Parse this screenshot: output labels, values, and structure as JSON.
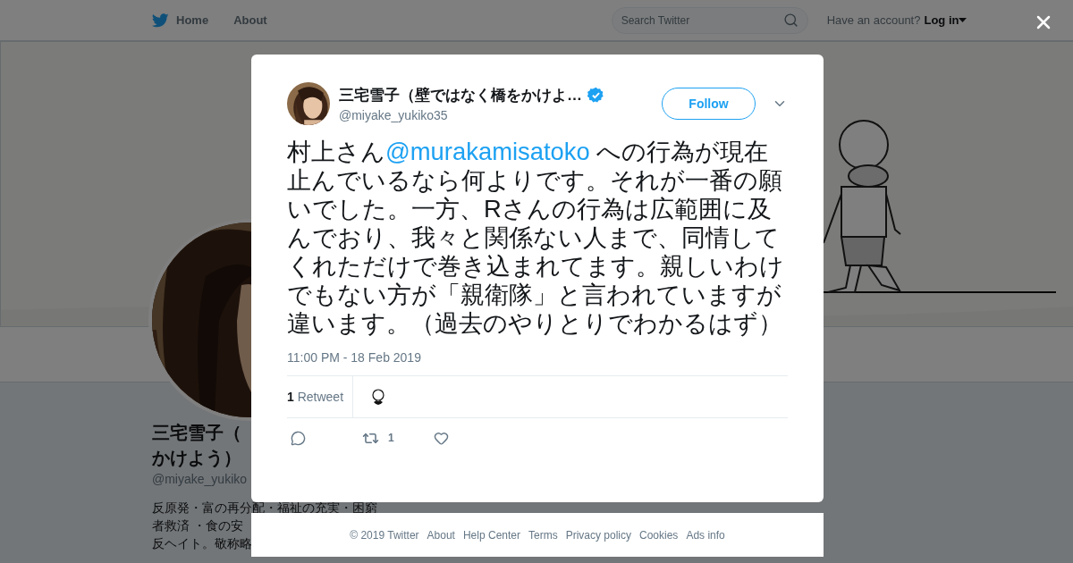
{
  "header": {
    "nav": [
      {
        "label": "Home"
      },
      {
        "label": "About"
      }
    ],
    "search": {
      "placeholder": "Search Twitter"
    },
    "account": {
      "prompt": "Have an account?",
      "login": "Log in"
    }
  },
  "profile": {
    "name_lines": [
      "三宅雪子（",
      "かけよう）"
    ],
    "handle": "@miyake_yukiko",
    "bio_lines": [
      "反原発・富の再分配・福祉の充実・困窮",
      "者救済 ・食の安",
      "反ヘイト。敬称略"
    ]
  },
  "tweet": {
    "author": {
      "name": "三宅雪子（壁ではなく橋をかけよ…",
      "handle": "@miyake_yukiko35",
      "verified": true
    },
    "follow": "Follow",
    "text": [
      {
        "kind": "plain",
        "text": "村上さん"
      },
      {
        "kind": "mention",
        "text": "@murakamisatoko"
      },
      {
        "kind": "plain",
        "text": " への行為が現在止んでいるなら何よりです。それが一番の願いでした。一方、Rさんの行為は広範囲に及んでおり、我々と関係ない人まで、同情してくれただけで巻き込まれてます。親しいわけでもない方が「親衛隊」と言われていますが違います。（過去のやりとりでわかるはず）"
      }
    ],
    "timestamp": "11:00 PM - 18 Feb 2019",
    "retweets": "**1** Retweet",
    "actions": [
      {
        "kind": "reply"
      },
      {
        "kind": "retweet",
        "count": "1"
      },
      {
        "kind": "like"
      }
    ]
  },
  "footer": [
    "© 2019 Twitter",
    "About",
    "Help Center",
    "Terms",
    "Privacy policy",
    "Cookies",
    "Ads info"
  ]
}
